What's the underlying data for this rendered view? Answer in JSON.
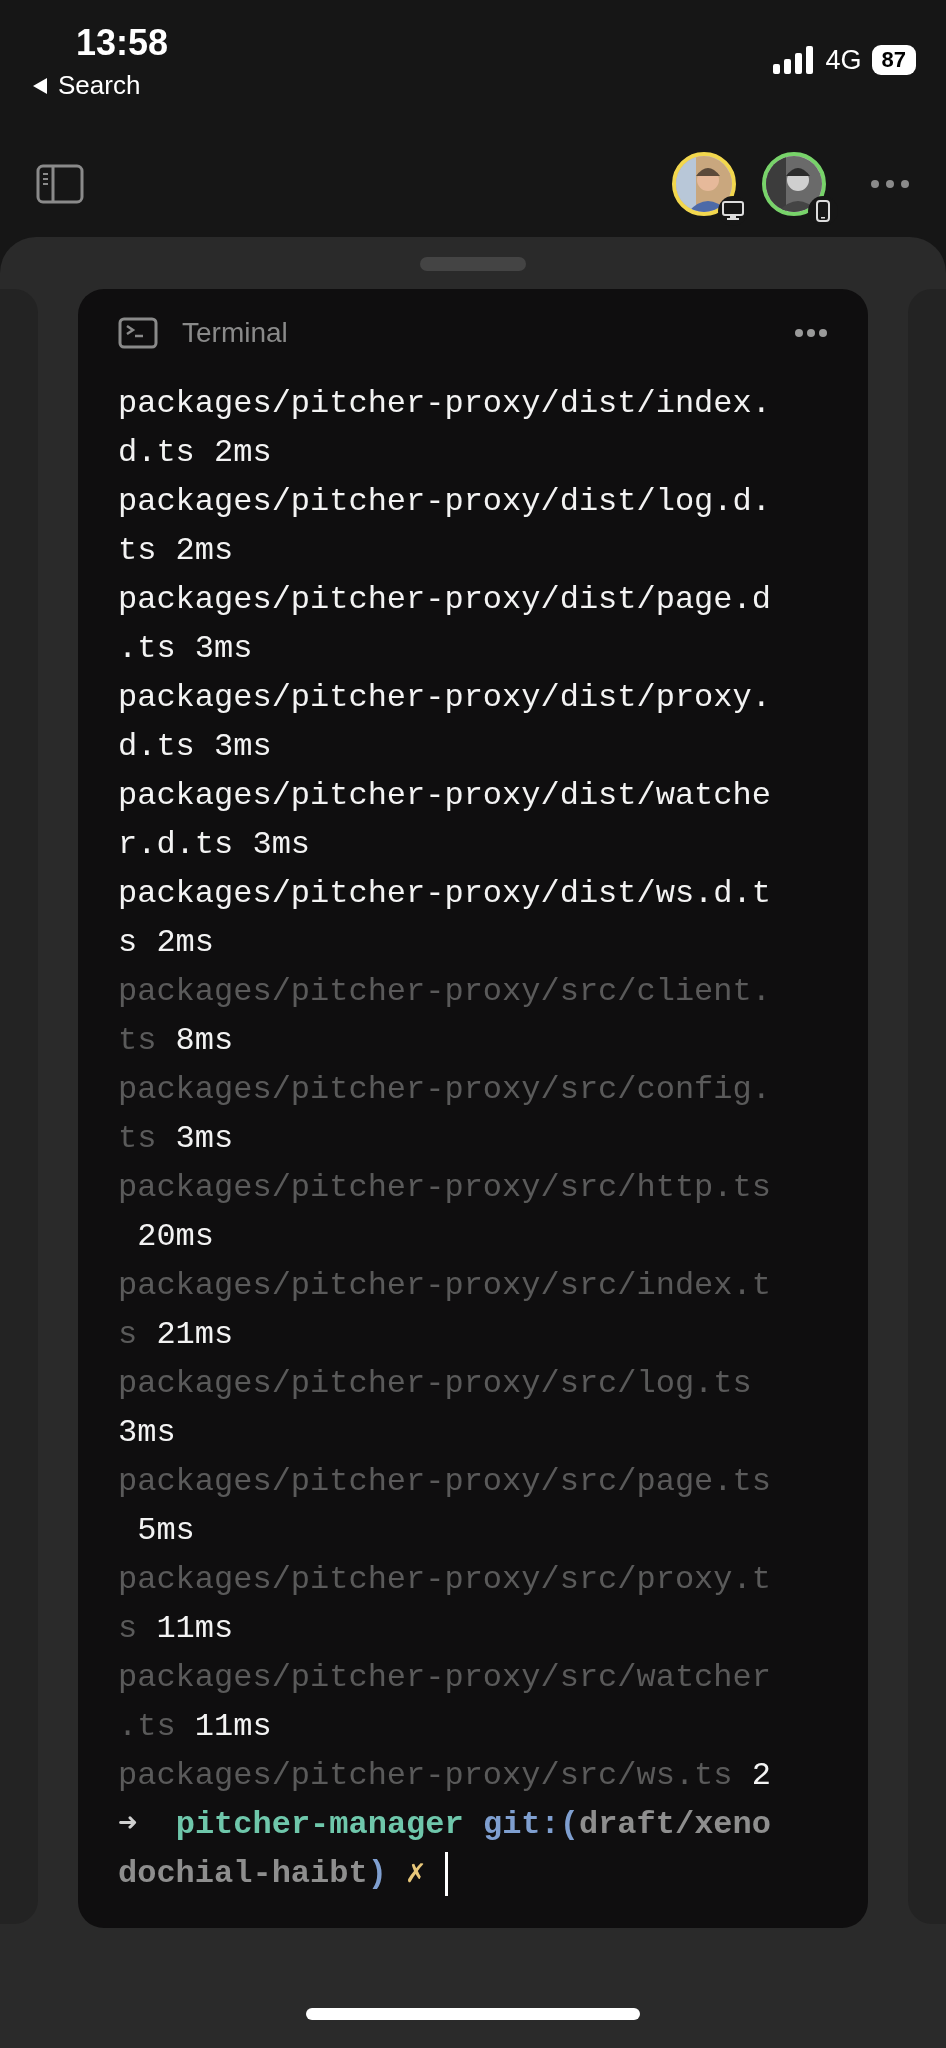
{
  "status_bar": {
    "time": "13:58",
    "back_label": "Search",
    "network": "4G",
    "battery": "87"
  },
  "toolbar": {
    "collaborators": [
      {
        "color": "#f2d74e",
        "kind": "desktop"
      },
      {
        "color": "#78d36a",
        "kind": "phone"
      }
    ]
  },
  "terminal": {
    "title": "Terminal",
    "lines": [
      {
        "path": "packages/pitcher-proxy/dist/index.d.ts",
        "dim": false,
        "time": "2ms"
      },
      {
        "path": "packages/pitcher-proxy/dist/log.d.ts",
        "dim": false,
        "time": "2ms"
      },
      {
        "path": "packages/pitcher-proxy/dist/page.d.ts",
        "dim": false,
        "time": "3ms"
      },
      {
        "path": "packages/pitcher-proxy/dist/proxy.d.ts",
        "dim": false,
        "time": "3ms"
      },
      {
        "path": "packages/pitcher-proxy/dist/watcher.d.ts",
        "dim": false,
        "time": "3ms"
      },
      {
        "path": "packages/pitcher-proxy/dist/ws.d.ts",
        "dim": false,
        "time": "2ms"
      },
      {
        "path": "packages/pitcher-proxy/src/client.ts",
        "dim": true,
        "time": "8ms"
      },
      {
        "path": "packages/pitcher-proxy/src/config.ts",
        "dim": true,
        "time": "3ms"
      },
      {
        "path": "packages/pitcher-proxy/src/http.ts",
        "dim": true,
        "time": "20ms"
      },
      {
        "path": "packages/pitcher-proxy/src/index.ts",
        "dim": true,
        "time": "21ms"
      },
      {
        "path": "packages/pitcher-proxy/src/log.ts",
        "dim": true,
        "time": "3ms"
      },
      {
        "path": "packages/pitcher-proxy/src/page.ts",
        "dim": true,
        "time": "5ms"
      },
      {
        "path": "packages/pitcher-proxy/src/proxy.ts",
        "dim": true,
        "time": "11ms"
      },
      {
        "path": "packages/pitcher-proxy/src/watcher.ts",
        "dim": true,
        "time": "11ms"
      },
      {
        "path": "packages/pitcher-proxy/src/ws.ts",
        "dim": true,
        "time": "2"
      }
    ],
    "prompt": [
      {
        "kind": "arrow",
        "text": "➜ "
      },
      {
        "kind": "dir",
        "text": " pitcher-manager"
      },
      {
        "kind": "git",
        "text": " git:("
      },
      {
        "kind": "branch",
        "text": "draft/xenodochial-haibt"
      },
      {
        "kind": "git",
        "text": ")"
      },
      {
        "kind": "dirty",
        "text": " ✗"
      }
    ]
  }
}
